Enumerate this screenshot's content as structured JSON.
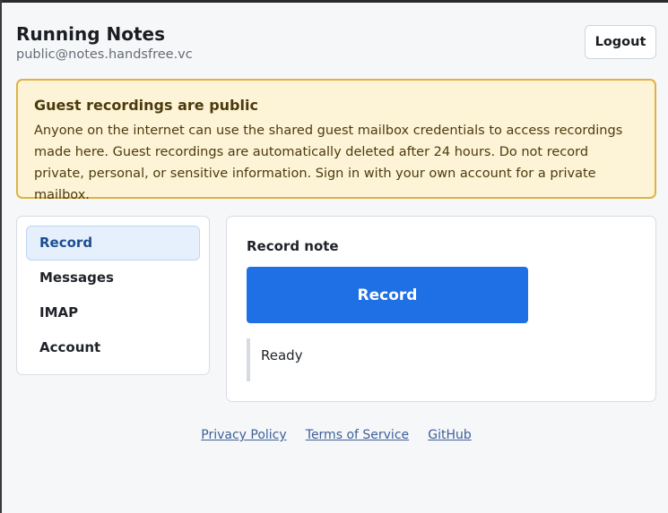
{
  "header": {
    "title": "Running Notes",
    "email": "public@notes.handsfree.vc",
    "logout_label": "Logout"
  },
  "warning": {
    "title": "Guest recordings are public",
    "body": "Anyone on the internet can use the shared guest mailbox credentials to access recordings made here. Guest recordings are automatically deleted after 24 hours. Do not record private, personal, or sensitive information. Sign in with your own account for a private mailbox."
  },
  "sidebar": {
    "items": [
      {
        "label": "Record",
        "active": true
      },
      {
        "label": "Messages",
        "active": false
      },
      {
        "label": "IMAP",
        "active": false
      },
      {
        "label": "Account",
        "active": false
      }
    ]
  },
  "main": {
    "section_title": "Record note",
    "record_label": "Record",
    "status": "Ready"
  },
  "footer": {
    "links": [
      "Privacy Policy",
      "Terms of Service",
      "GitHub"
    ]
  },
  "colors": {
    "accent": "#1f6fe5",
    "warning_bg": "#fdf4d7",
    "warning_border": "#e0b243",
    "active_nav_bg": "#e6f0fd"
  }
}
